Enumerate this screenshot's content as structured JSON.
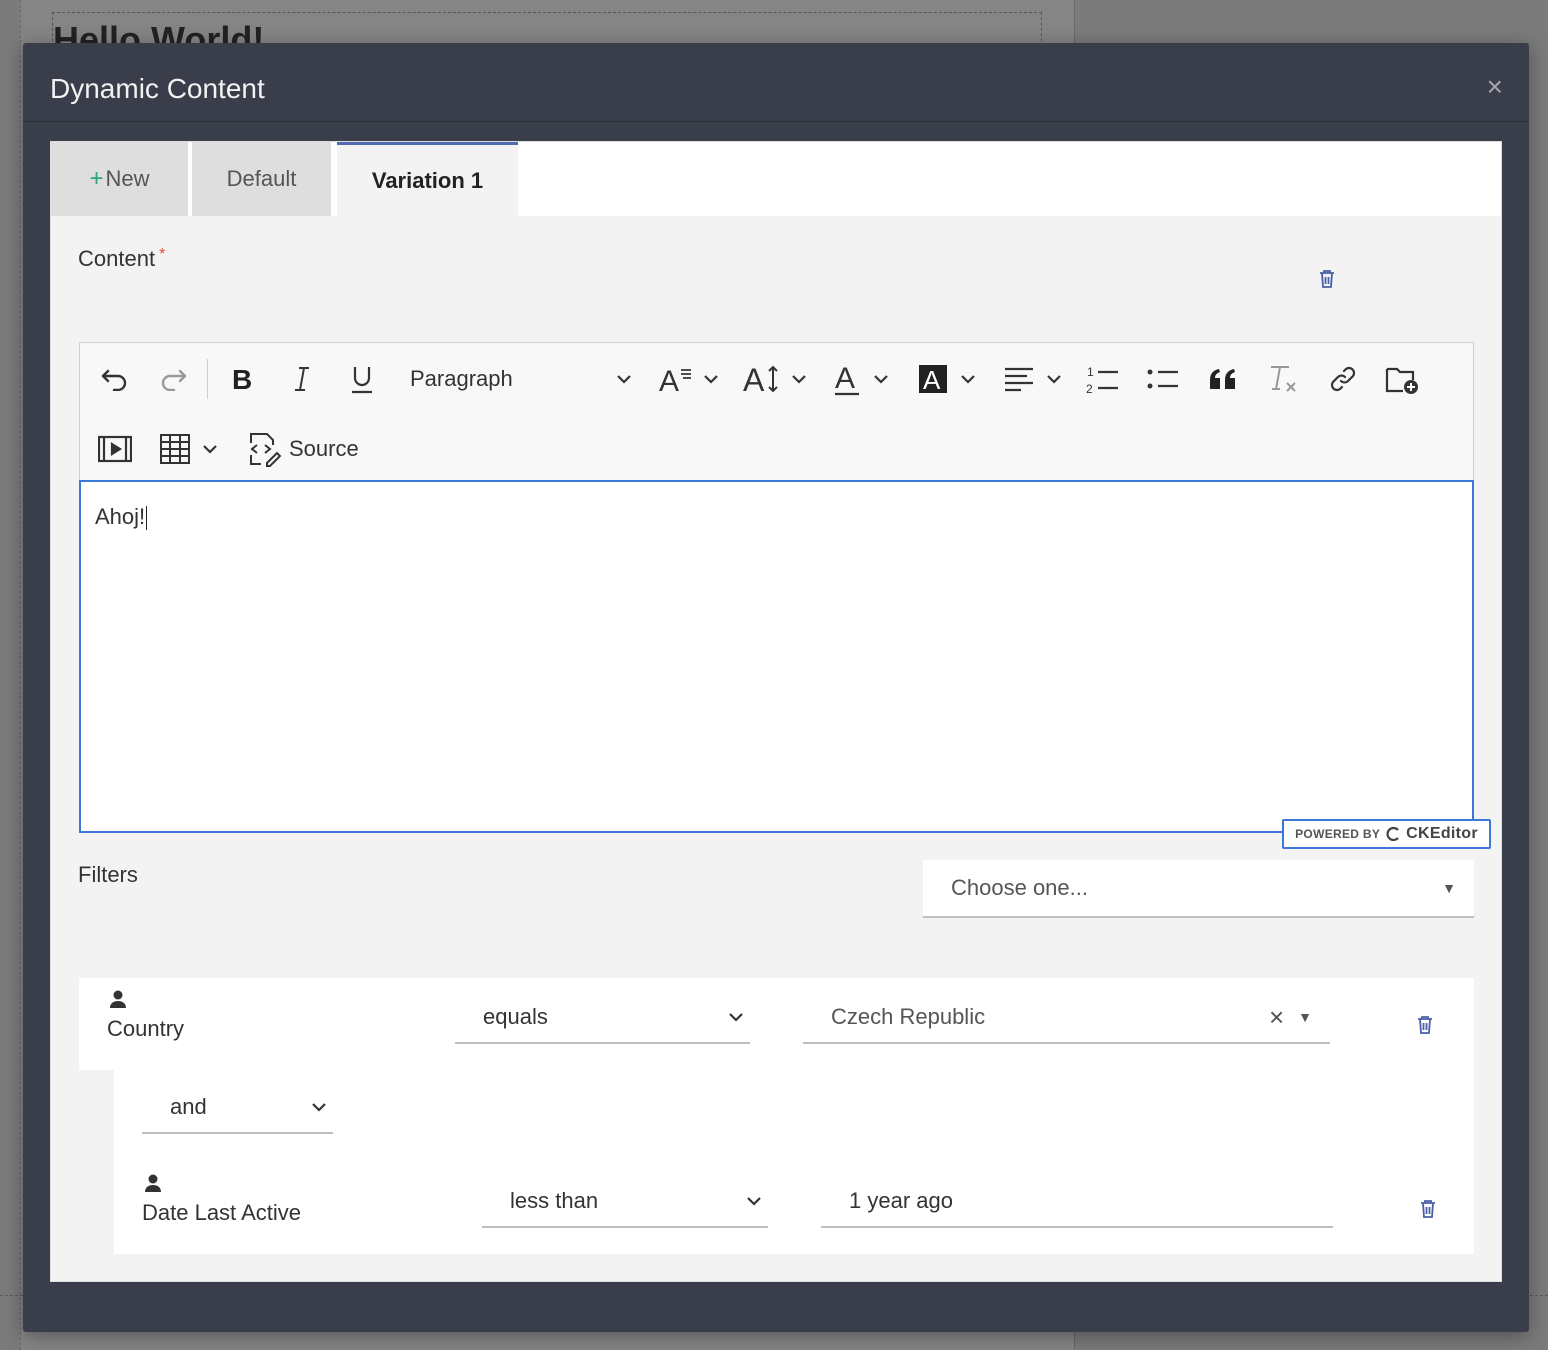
{
  "background": {
    "heading": "Hello World!"
  },
  "modal": {
    "title": "Dynamic Content",
    "close_label": "×"
  },
  "tabs": [
    {
      "label": "New",
      "prefix": "+"
    },
    {
      "label": "Default"
    },
    {
      "label": "Variation 1",
      "active": true
    }
  ],
  "content": {
    "label": "Content",
    "required_mark": "*"
  },
  "editor": {
    "toolbar": {
      "undo": "undo-icon",
      "redo": "redo-icon",
      "bold": "bold-icon",
      "italic": "italic-icon",
      "underline": "underline-icon",
      "heading_select": "Paragraph",
      "font_family": "font-family-icon",
      "font_size": "font-size-icon",
      "font_color": "font-color-icon",
      "background_color": "font-background-icon",
      "alignment": "align-left-icon",
      "numbered_list": "numbered-list-icon",
      "bulleted_list": "bulleted-list-icon",
      "blockquote": "blockquote-icon",
      "remove_format": "remove-format-icon",
      "link": "link-icon",
      "insert_media_folder": "folder-add-icon",
      "media_embed": "media-embed-icon",
      "table": "table-icon",
      "source_label": "Source"
    },
    "body_text": "Ahoj!",
    "powered_by": "POWERED BY",
    "brand": "CKEditor"
  },
  "filters": {
    "label": "Filters",
    "add_placeholder": "Choose one...",
    "rows": [
      {
        "field": "Country",
        "operator": "equals",
        "value": "Czech Republic"
      },
      {
        "glue": "and",
        "field": "Date Last Active",
        "operator": "less than",
        "value": "1 year ago"
      }
    ]
  },
  "colors": {
    "modal_bg": "#3a3e4a",
    "accent": "#4f6bb3",
    "editor_focus": "#3c78d8",
    "required": "#e0513c",
    "new_plus": "#2fa37a"
  }
}
